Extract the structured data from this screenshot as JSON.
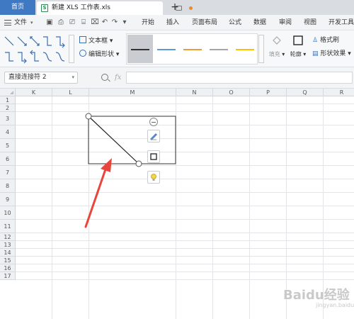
{
  "tabs": {
    "home": "首页",
    "file_title": "新建 XLS 工作表.xls",
    "xls_badge": "S",
    "add": "+"
  },
  "menu": {
    "file": "文件",
    "caret": "▾",
    "items": [
      "开始",
      "插入",
      "页面布局",
      "公式",
      "数据",
      "审阅",
      "视图",
      "开发工具"
    ]
  },
  "ribbon": {
    "text_box": "文本框",
    "edit_shape": "编辑形状",
    "fill": "填充",
    "outline": "轮廓",
    "format_painter": "格式刷",
    "shape_effects": "形状效果",
    "line_style_colors": [
      "#333333",
      "#5b9bd5",
      "#ed9b3b",
      "#a5a5a5",
      "#ffc000"
    ]
  },
  "formula_bar": {
    "name_box": "直接连接符 2",
    "fx": "fx",
    "value": ""
  },
  "sheet": {
    "columns": [
      "K",
      "L",
      "M",
      "N",
      "O",
      "P",
      "Q",
      "R"
    ],
    "rows": [
      "1",
      "2",
      "3",
      "4",
      "5",
      "6",
      "7",
      "8",
      "9",
      "10",
      "11",
      "12",
      "13",
      "14",
      "15",
      "16",
      "17"
    ]
  },
  "colors": {
    "home_tab": "#3f79c4",
    "arrow": "#e8453c",
    "accent": "#2e8b57"
  },
  "watermark": {
    "text": "Baidu经验",
    "sub": "jingyan.baidu.com"
  }
}
